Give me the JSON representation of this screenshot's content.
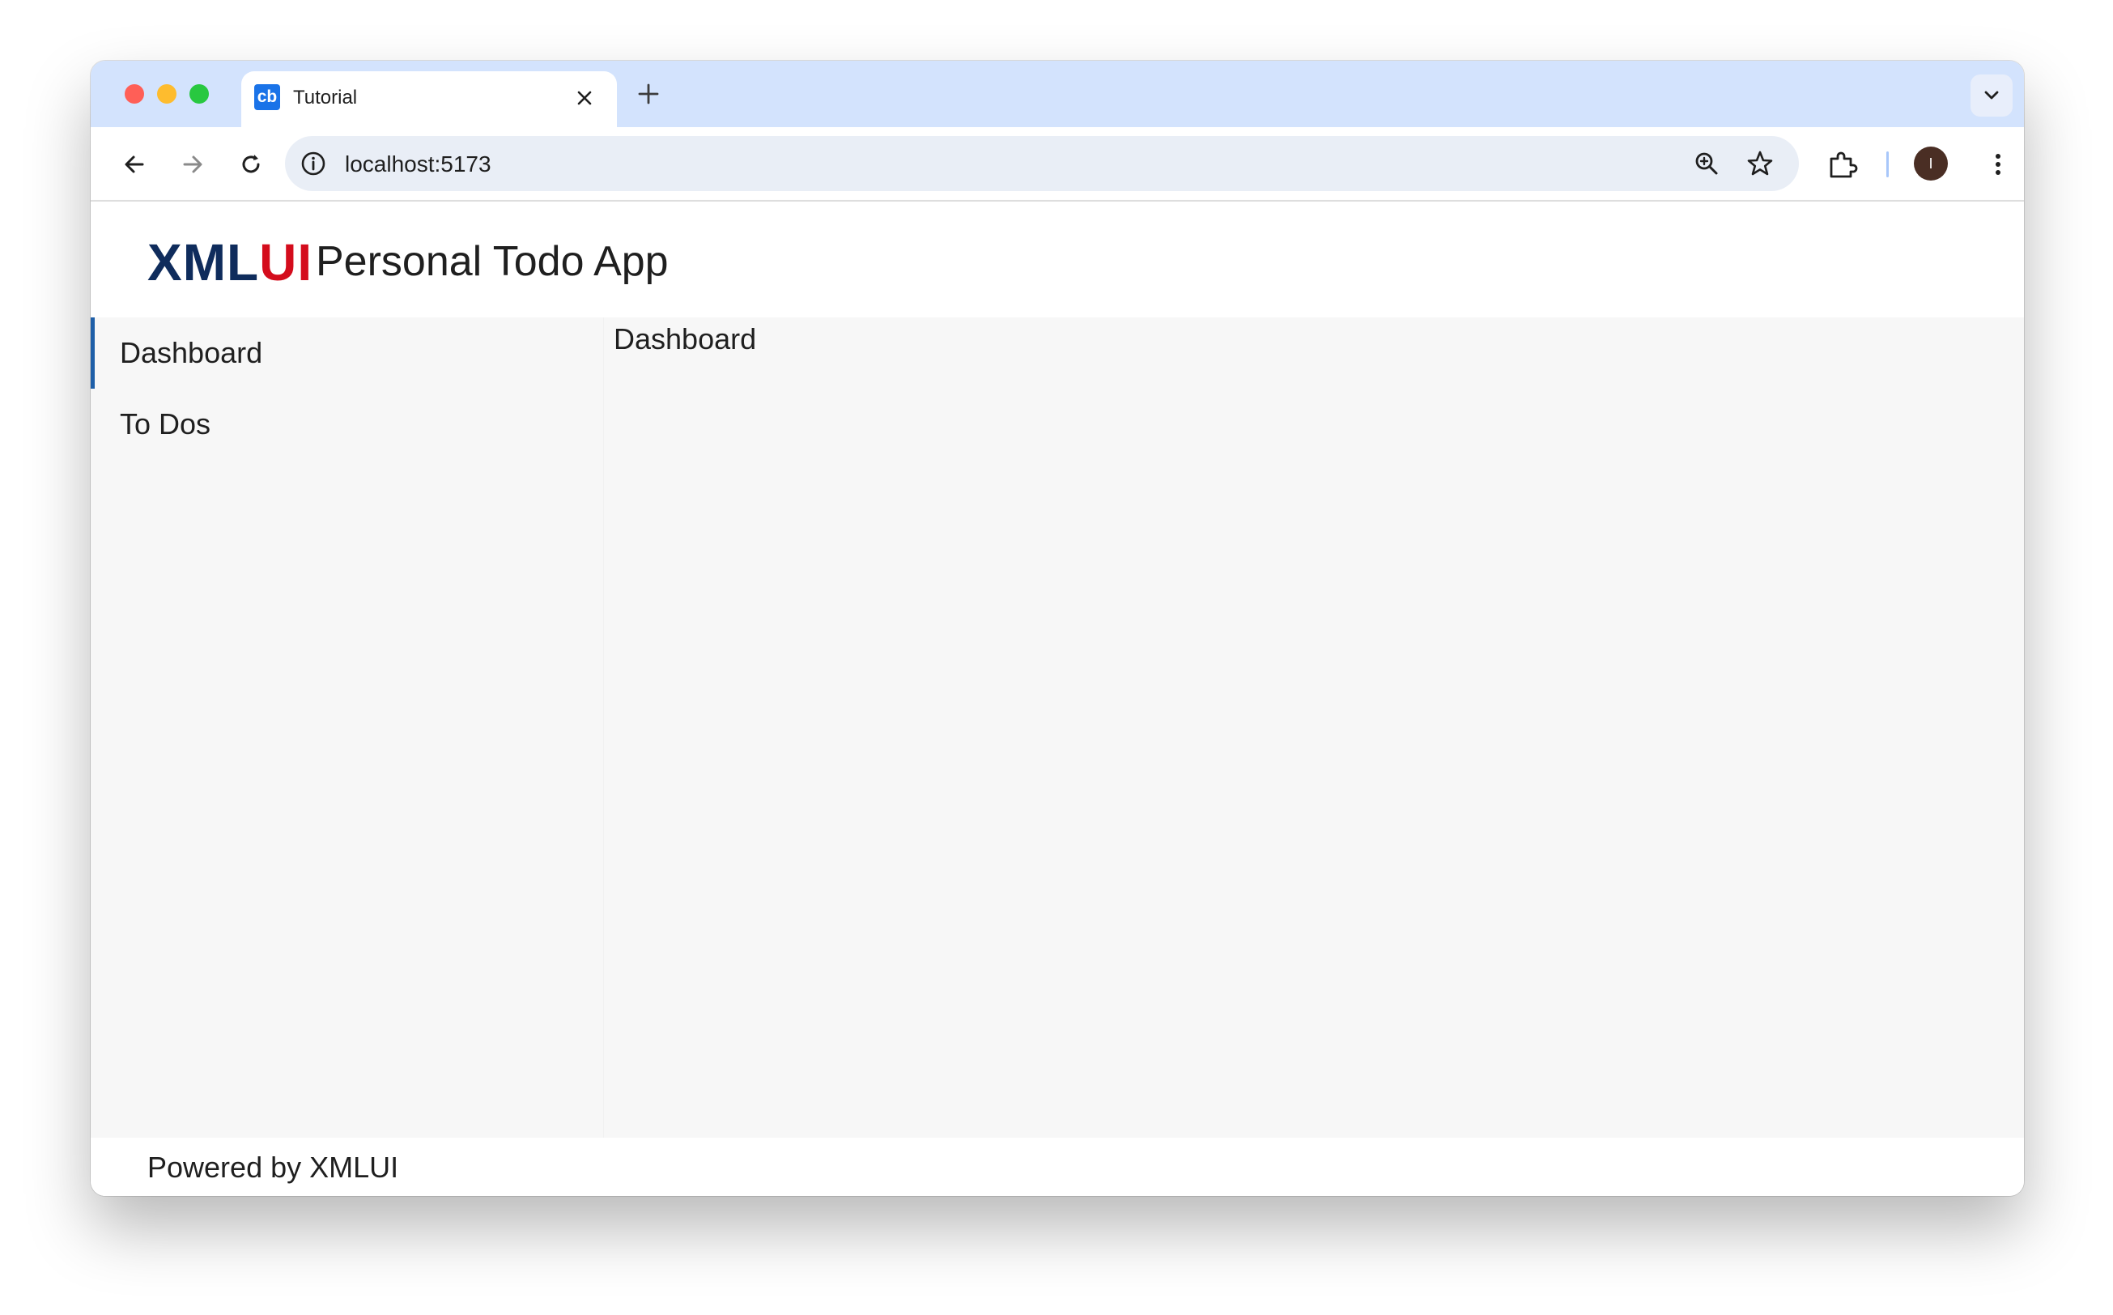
{
  "browser": {
    "tab": {
      "favicon_text": "cb",
      "title": "Tutorial"
    },
    "url": "localhost:5173",
    "profile_initial": "I"
  },
  "icons": {
    "tab_close": "close-icon",
    "new_tab": "plus-icon",
    "tab_list": "chevron-down-icon",
    "back": "back-arrow-icon",
    "forward": "forward-arrow-icon",
    "reload": "reload-icon",
    "site_info": "info-icon",
    "zoom": "zoom-icon",
    "bookmark": "star-icon",
    "extensions": "puzzle-icon",
    "menu": "kebab-menu-icon"
  },
  "colors": {
    "brand_dark": "#0f2c5c",
    "brand_red": "#d40c1c",
    "active_indicator": "#1f5fa8",
    "tabstrip_bg": "#d3e3fd"
  },
  "app": {
    "logo_part1": "XML",
    "logo_part2": "UI",
    "title": "Personal Todo App",
    "nav": [
      {
        "label": "Dashboard",
        "active": true
      },
      {
        "label": "To Dos",
        "active": false
      }
    ],
    "content_heading": "Dashboard",
    "footer": "Powered by XMLUI"
  }
}
